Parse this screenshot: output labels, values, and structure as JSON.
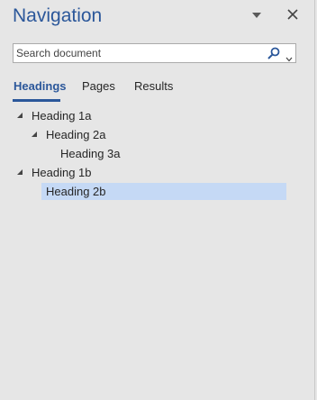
{
  "pane": {
    "title": "Navigation",
    "menu_icon": "triangle-down-icon",
    "close_icon": "close-icon"
  },
  "search": {
    "placeholder": "Search document",
    "value": "",
    "icon": "search-icon",
    "dropdown_icon": "chevron-down-icon"
  },
  "tabs": [
    {
      "label": "Headings",
      "active": true
    },
    {
      "label": "Pages",
      "active": false
    },
    {
      "label": "Results",
      "active": false
    }
  ],
  "tree": [
    {
      "label": "Heading 1a",
      "level": 1,
      "expanded": true
    },
    {
      "label": "Heading 2a",
      "level": 2,
      "expanded": true
    },
    {
      "label": "Heading 3a",
      "level": 3
    },
    {
      "label": "Heading 1b",
      "level": 1,
      "expanded": true
    },
    {
      "label": "Heading 2b",
      "level": 2,
      "selected": true
    }
  ],
  "colors": {
    "accent": "#2b579a",
    "selection": "#c5d9f5",
    "background": "#e6e6e6"
  }
}
